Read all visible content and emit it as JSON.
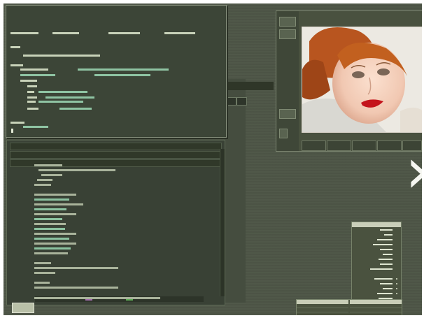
{
  "colors": {
    "desktop": "#4d5546",
    "terminal": "#394135",
    "code_text": "#b9c3aa",
    "code_accent": "#8bc2a0"
  },
  "icons": [
    "chevron-right-icon",
    "close-icon"
  ]
}
